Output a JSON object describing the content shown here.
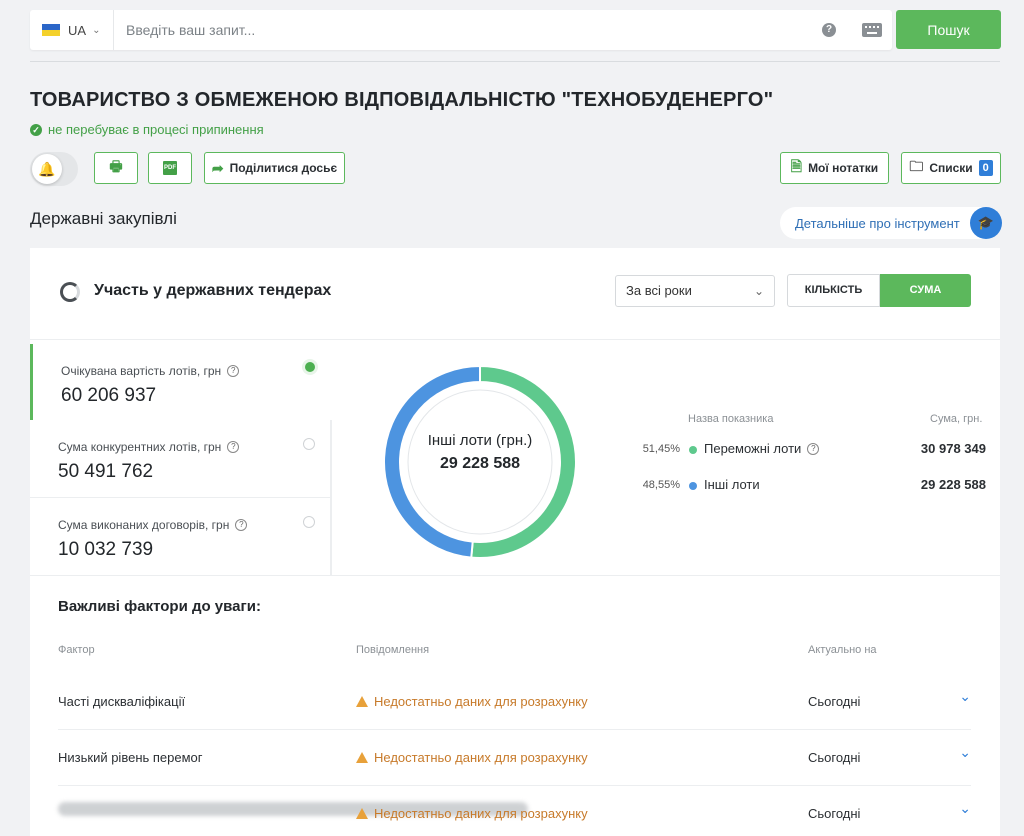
{
  "search": {
    "lang": "UA",
    "placeholder": "Введіть ваш запит...",
    "button": "Пошук"
  },
  "company": {
    "title": "ТОВАРИСТВО З ОБМЕЖЕНОЮ ВІДПОВІДАЛЬНІСТЮ \"ТЕХНОБУДЕНЕРГО\"",
    "status": "не перебуває в процесі припинення"
  },
  "actions": {
    "share": "Поділитися досьє",
    "notes": "Мої нотатки",
    "lists": "Списки",
    "lists_count": "0",
    "pdf": "PDF"
  },
  "section": {
    "title": "Державні закупівлі",
    "more_info": "Детальніше про інструмент"
  },
  "card": {
    "title": "Участь у державних тендерах",
    "year_select": "За всі роки",
    "toggle_count": "КІЛЬКІСТЬ",
    "toggle_sum": "СУМА"
  },
  "metrics": [
    {
      "label": "Очікувана вартість лотів, грн",
      "value": "60 206 937"
    },
    {
      "label": "Сума конкурентних лотів, грн",
      "value": "50 491 762"
    },
    {
      "label": "Сума виконаних договорів, грн",
      "value": "10 032 739"
    }
  ],
  "donut": {
    "center_label": "Інші лоти (грн.)",
    "center_value": "29 228 588",
    "colors": {
      "won": "#5ec98d",
      "other": "#4d94e0"
    }
  },
  "legend": {
    "head_name": "Назва показника",
    "head_sum": "Сума, грн.",
    "rows": [
      {
        "pct": "51,45%",
        "name": "Переможні лоти",
        "sum": "30 978 349",
        "color": "#5ec98d"
      },
      {
        "pct": "48,55%",
        "name": "Інші лоти",
        "sum": "29 228 588",
        "color": "#4d94e0"
      }
    ]
  },
  "chart_data": {
    "type": "pie",
    "categories": [
      "Переможні лоти",
      "Інші лоти"
    ],
    "values": [
      30978349,
      29228588
    ],
    "percent_labels": [
      "51,45%",
      "48,55%"
    ]
  },
  "factors": {
    "title": "Важливі фактори до уваги:",
    "columns": [
      "Фактор",
      "Повідомлення",
      "Актуально на"
    ],
    "rows": [
      {
        "factor": "Часті дискваліфікації",
        "message": "Недостатньо даних для розрахунку",
        "date": "Сьогодні"
      },
      {
        "factor": "Низький рівень перемог",
        "message": "Недостатньо даних для розрахунку",
        "date": "Сьогодні"
      },
      {
        "factor": "",
        "message": "Недостатньо даних для розрахунку",
        "date": "Сьогодні"
      }
    ]
  }
}
